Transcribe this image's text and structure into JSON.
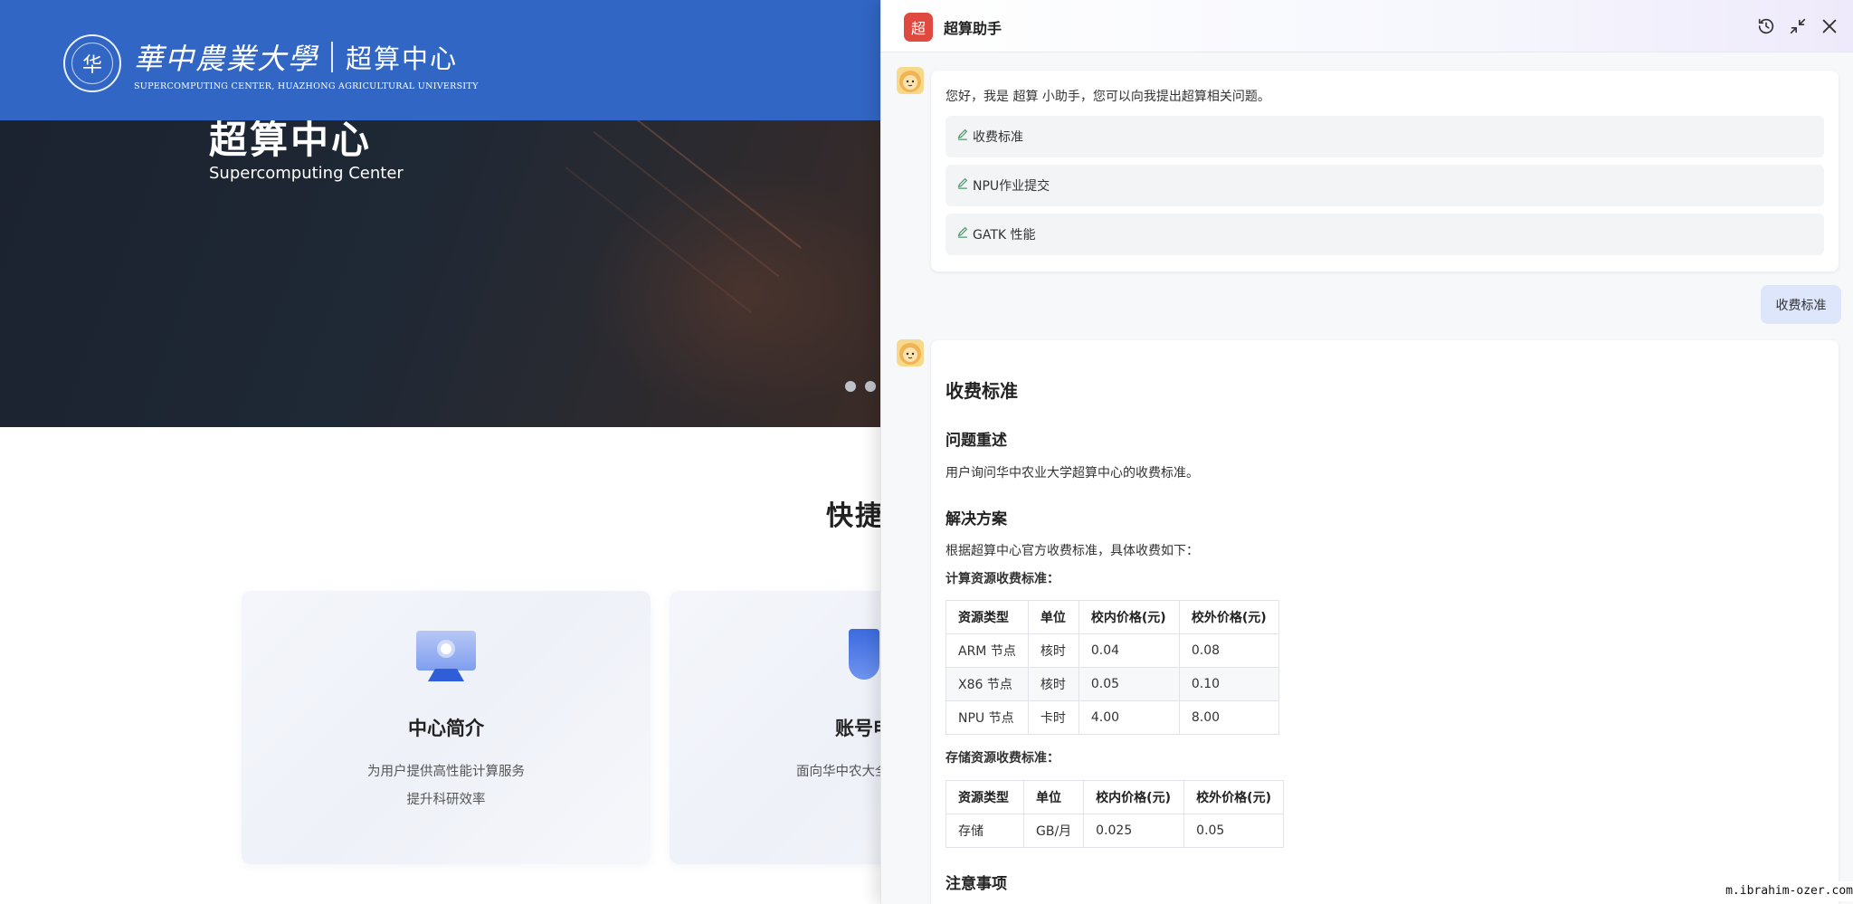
{
  "site": {
    "logo_cn": "華中農業大學",
    "logo_center": "超算中心",
    "logo_en": "SUPERCOMPUTING CENTER, HUAZHONG AGRICULTURAL UNIVERSITY",
    "hero_title": "超算中心",
    "hero_subtitle": "Supercomputing Center",
    "quick_title": "快捷",
    "cards": [
      {
        "title": "中心简介",
        "desc_line1": "为用户提供高性能计算服务",
        "desc_line2": "提升科研效率"
      },
      {
        "title": "账号申",
        "desc_line1": "面向华中农大全"
      }
    ],
    "colors": {
      "header_blue": "#3266c4",
      "logo_red": "#e0493f",
      "user_bubble": "#dde6fb"
    }
  },
  "chat": {
    "logo_char": "超",
    "title": "超算助手",
    "greeting": "您好，我是 超算 小助手，您可以向我提出超算相关问题。",
    "suggestions": [
      "收费标准",
      "NPU作业提交",
      "GATK 性能"
    ],
    "user_message": "收费标准",
    "answer": {
      "title": "收费标准",
      "section1_title": "问题重述",
      "section1_text": "用户询问华中农业大学超算中心的收费标准。",
      "section2_title": "解决方案",
      "section2_text": "根据超算中心官方收费标准，具体收费如下：",
      "compute_label": "计算资源收费标准：",
      "compute_table": {
        "headers": [
          "资源类型",
          "单位",
          "校内价格(元)",
          "校外价格(元)"
        ],
        "rows": [
          [
            "ARM 节点",
            "核时",
            "0.04",
            "0.08"
          ],
          [
            "X86 节点",
            "核时",
            "0.05",
            "0.10"
          ],
          [
            "NPU 节点",
            "卡时",
            "4.00",
            "8.00"
          ]
        ]
      },
      "storage_label": "存储资源收费标准：",
      "storage_table": {
        "headers": [
          "资源类型",
          "单位",
          "校内价格(元)",
          "校外价格(元)"
        ],
        "rows": [
          [
            "存储",
            "GB/月",
            "0.025",
            "0.05"
          ]
        ]
      },
      "section3_title": "注意事项"
    }
  },
  "watermark": "m.ibrahim-ozer.com"
}
